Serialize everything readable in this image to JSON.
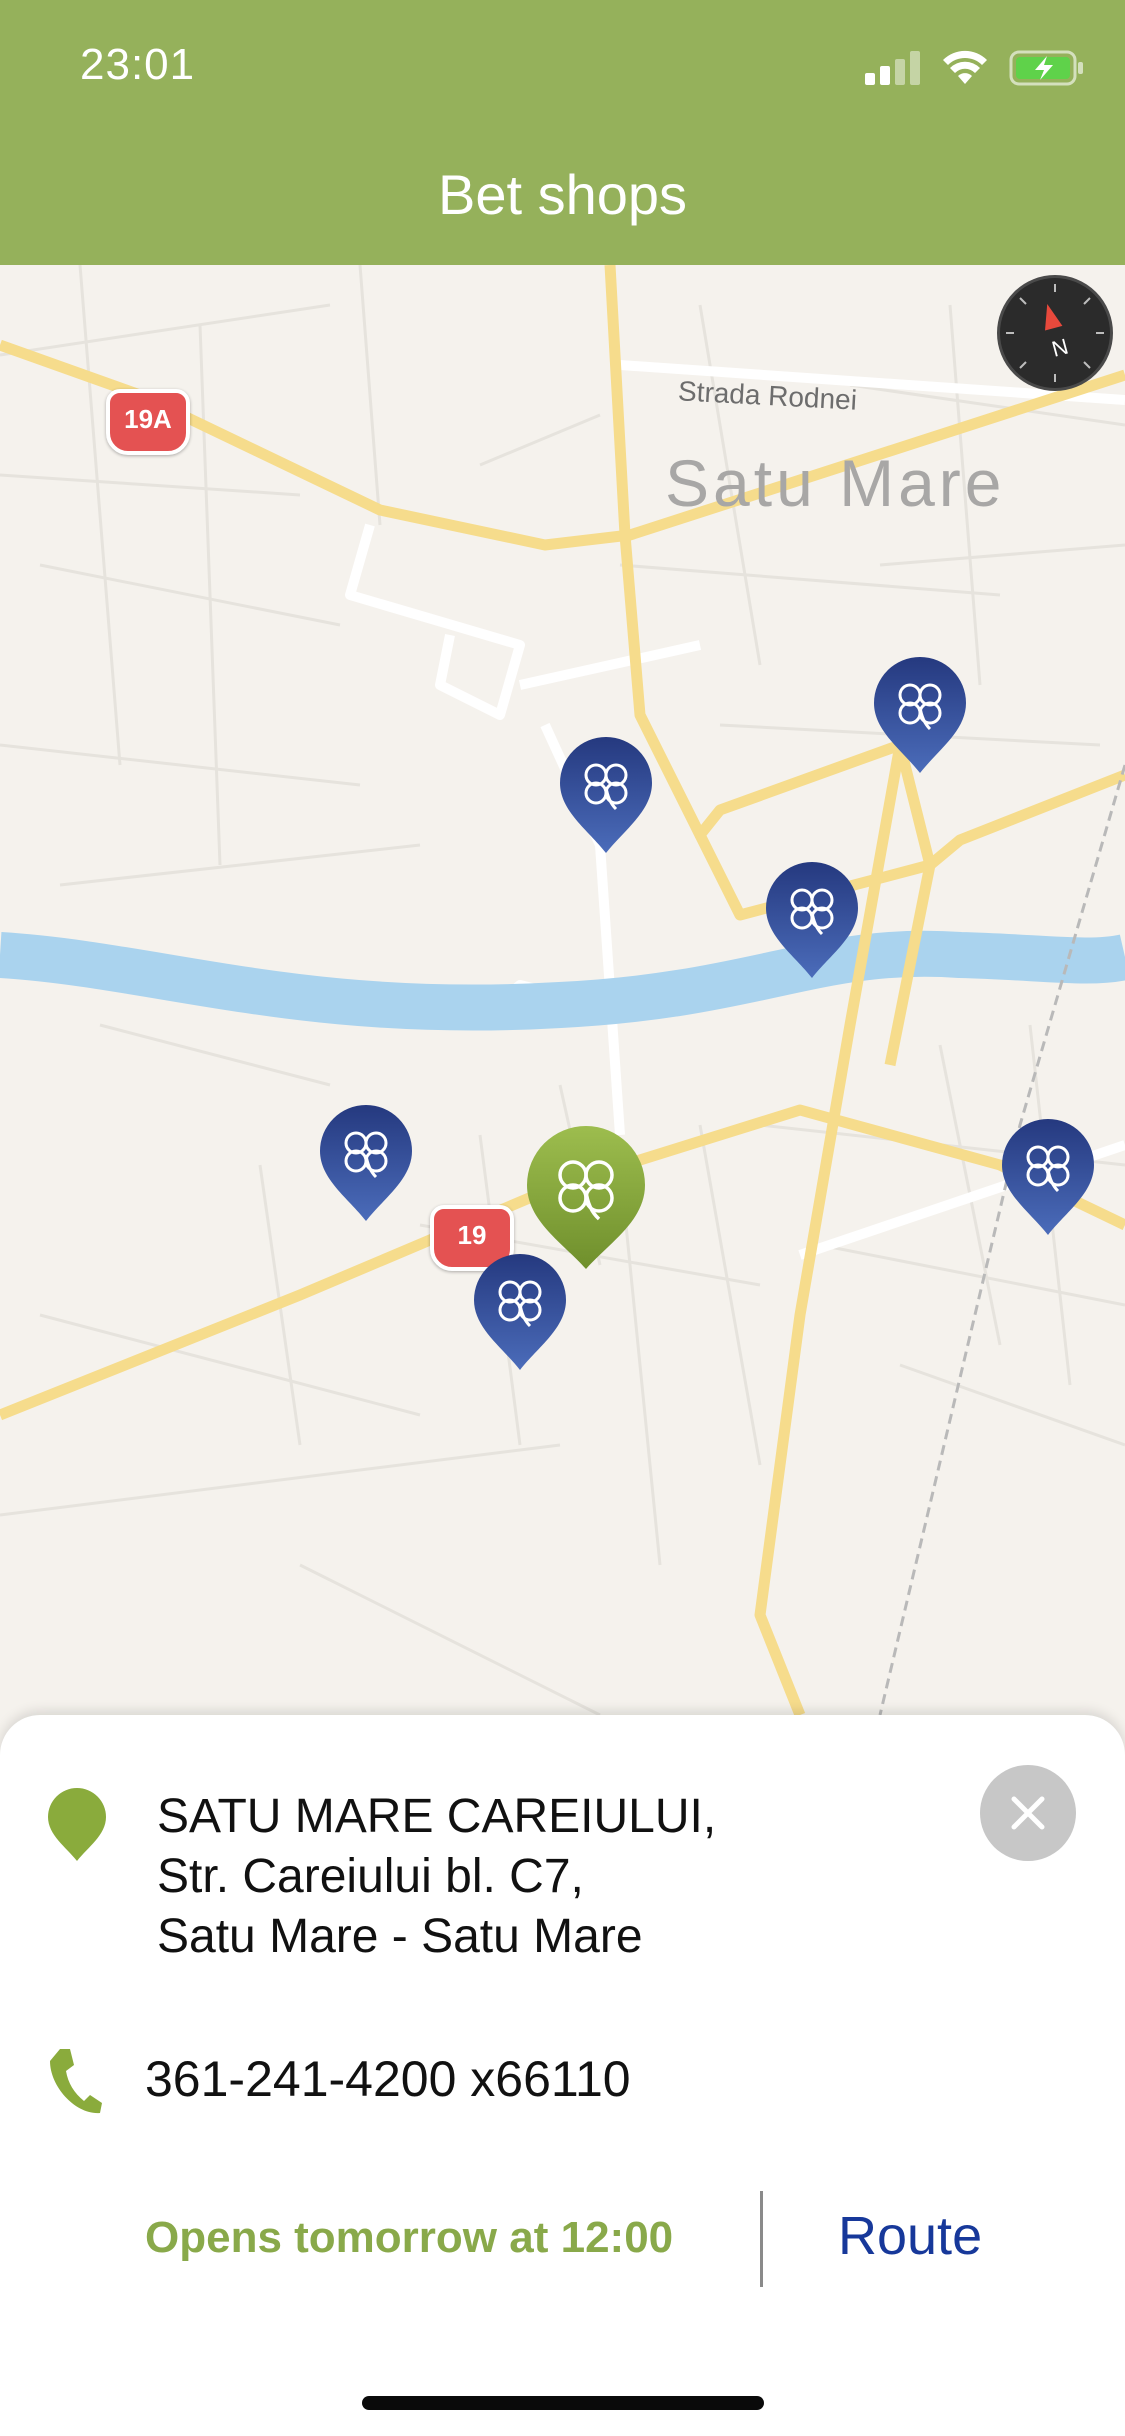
{
  "status_bar": {
    "time": "23:01"
  },
  "nav": {
    "title": "Bet shops"
  },
  "map": {
    "city_label": "Satu Mare",
    "street_label": "Strada Rodnei",
    "road_shields": [
      "19A",
      "19"
    ],
    "colors": {
      "pin_default": "#2c4891",
      "pin_active": "#8aab3c",
      "river": "#aad3ee",
      "major_road": "#f6dc8c"
    }
  },
  "shop": {
    "address_lines": [
      "SATU MARE CAREIULUI,",
      "Str. Careiului bl. C7,",
      "Satu Mare - Satu Mare"
    ],
    "phone": "361-241-4200 x66110",
    "hours_status": "Opens tomorrow at 12:00",
    "route_label": "Route"
  },
  "colors": {
    "header": "#95b15b",
    "accent_green": "#89a94a",
    "route_blue": "#17389a"
  }
}
